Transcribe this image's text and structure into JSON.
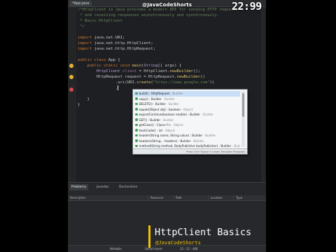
{
  "editor": {
    "tab_label": "*App.java",
    "code_lines": [
      {
        "t": [
          [
            "/*HttpClient in Java provides a modern API for sending HTTP requests",
            "cmt"
          ]
        ]
      },
      {
        "t": [
          [
            " * and receiving responses asynchronously and synchronously.",
            "cmt"
          ]
        ]
      },
      {
        "t": [
          [
            " * Basic HttpClient",
            "cmt"
          ]
        ]
      },
      {
        "t": [
          [
            " */",
            "cmt"
          ]
        ]
      },
      {
        "t": [
          [
            "",
            "plain"
          ]
        ]
      },
      {
        "t": [
          [
            "import ",
            "kw"
          ],
          [
            "java.net.URI;",
            "plain"
          ]
        ]
      },
      {
        "t": [
          [
            "import ",
            "kw"
          ],
          [
            "java.net.http.HttpClient;",
            "plain"
          ]
        ]
      },
      {
        "t": [
          [
            "import ",
            "kw"
          ],
          [
            "java.net.http.HttpRequest;",
            "plain"
          ]
        ]
      },
      {
        "t": [
          [
            "",
            "plain"
          ]
        ]
      },
      {
        "t": [
          [
            "public class ",
            "kw"
          ],
          [
            "App ",
            "plain"
          ],
          [
            "{",
            "plain"
          ]
        ]
      },
      {
        "t": [
          [
            "    public static void ",
            "kw"
          ],
          [
            "main",
            "fn"
          ],
          [
            "(",
            "plain"
          ],
          [
            "String",
            "typ"
          ],
          [
            "[] args) {",
            "plain"
          ]
        ]
      },
      {
        "t": [
          [
            "        HttpClient ",
            "typ"
          ],
          [
            "client",
            "var"
          ],
          [
            " = HttpClient.",
            "plain"
          ],
          [
            "newBuilder",
            "fn"
          ],
          [
            "();",
            "plain"
          ]
        ]
      },
      {
        "t": [
          [
            "        HttpRequest request = HttpRequest.",
            "plain"
          ],
          [
            "newBuilder",
            "fn"
          ],
          [
            "()",
            "plain"
          ]
        ]
      },
      {
        "t": [
          [
            "                .uri(URI.",
            "plain"
          ],
          [
            "create",
            "fn"
          ],
          [
            "(",
            "plain"
          ],
          [
            "\"https://www.google.com\"",
            "str"
          ],
          [
            "))",
            "plain"
          ]
        ]
      },
      {
        "t": [
          [
            "                .",
            "plain"
          ]
        ],
        "cursor": true
      },
      {
        "t": [
          [
            "",
            "plain"
          ]
        ]
      },
      {
        "t": [
          [
            "    }",
            "plain"
          ]
        ]
      },
      {
        "t": [
          [
            "}",
            "plain"
          ]
        ]
      }
    ]
  },
  "autocomplete": {
    "items": [
      {
        "sig": "build() : HttpRequest",
        "src": "Builder"
      },
      {
        "sig": "copy() : Builder",
        "src": "Builder"
      },
      {
        "sig": "DELETE() : Builder",
        "src": "Builder"
      },
      {
        "sig": "equals(Object obj) : boolean",
        "src": "Object"
      },
      {
        "sig": "expectContinue(boolean enable) : Builder",
        "src": "Builder"
      },
      {
        "sig": "GET() : Builder",
        "src": "Builder"
      },
      {
        "sig": "getClass() : Class<?>",
        "src": "Object"
      },
      {
        "sig": "hashCode() : int",
        "src": "Object"
      },
      {
        "sig": "header(String name, String value) : Builder",
        "src": "Builder"
      },
      {
        "sig": "headers(String... headers) : Builder",
        "src": "Builder"
      },
      {
        "sig": "method(String method, BodyPublisher bodyPublisher) : Builder",
        "src": "Builder"
      }
    ],
    "footer": "Press 'Ctrl+Space' to show Template Proposals"
  },
  "bottom_panel": {
    "tabs": [
      "Problems",
      "Javadoc",
      "Declaration"
    ],
    "columns": [
      "Description",
      "Resource",
      "Path",
      "Location",
      "Type"
    ]
  },
  "status_bar": {
    "mode": "Writable",
    "insert": "Smart Insert",
    "position": "15 : 22 : 486"
  },
  "overlay": {
    "channel": "@JavaCodeShorts",
    "clock": "22:99",
    "title": "HttpClient Basics",
    "handle": "@JavaCodeShorts"
  },
  "colors": {
    "accent": "#f2c200",
    "selection": "#c8ddf6"
  }
}
